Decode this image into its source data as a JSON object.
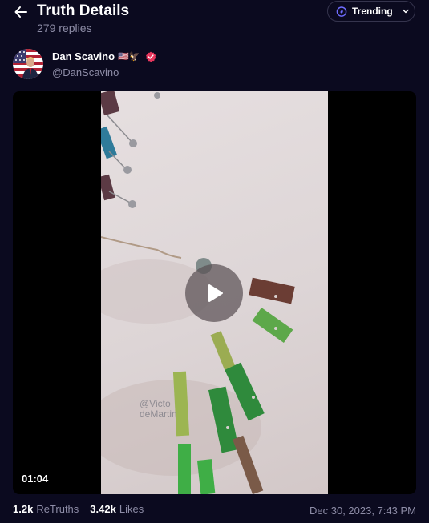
{
  "header": {
    "title": "Truth Details",
    "replies": "279 replies",
    "trending_label": "Trending"
  },
  "author": {
    "name": "Dan Scavino",
    "emoji": "🇺🇸🦅",
    "handle": "@DanScavino"
  },
  "video": {
    "duration": "01:04",
    "watermark": "@Victo\ndeMartin"
  },
  "stats": {
    "retruths_count": "1.2k",
    "retruths_label": "ReTruths",
    "likes_count": "3.42k",
    "likes_label": "Likes"
  },
  "timestamp": "Dec 30, 2023, 7:43 PM",
  "colors": {
    "background": "#0b0a1f",
    "muted_text": "#8d8ca6",
    "verified_badge": "#e8365d",
    "trending_icon": "#6f6cff"
  },
  "icons": [
    "back-arrow-icon",
    "trending-flame-icon",
    "chevron-down-icon",
    "verified-badge-icon",
    "play-icon"
  ]
}
